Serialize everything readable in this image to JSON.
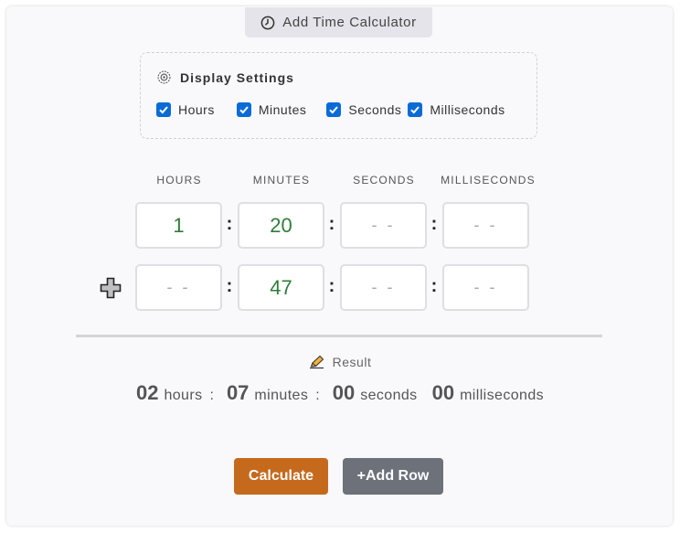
{
  "header": {
    "title": "Add Time Calculator",
    "icon": "clock-icon"
  },
  "settings": {
    "title": "Display Settings",
    "icon": "gear-icon",
    "options": [
      {
        "label": "Hours",
        "checked": true
      },
      {
        "label": "Minutes",
        "checked": true
      },
      {
        "label": "Seconds",
        "checked": true
      },
      {
        "label": "Milliseconds",
        "checked": true
      }
    ]
  },
  "columns": [
    "HOURS",
    "MINUTES",
    "SECONDS",
    "MILLISECONDS"
  ],
  "rows": [
    {
      "operator": "",
      "values": [
        "1",
        "20",
        "- -",
        "- -"
      ]
    },
    {
      "operator": "plus",
      "values": [
        "- -",
        "47",
        "- -",
        "- -"
      ]
    }
  ],
  "result": {
    "label": "Result",
    "icon": "pencil-icon",
    "hours": "02",
    "hours_unit": "hours",
    "minutes": "07",
    "minutes_unit": "minutes",
    "seconds": "00",
    "seconds_unit": "seconds",
    "milliseconds": "00",
    "milliseconds_unit": "milliseconds",
    "separator": ":"
  },
  "buttons": {
    "calculate": "Calculate",
    "add_row": "+Add Row"
  },
  "colors": {
    "checkbox": "#0b6bd6",
    "value_text": "#2f7d3a",
    "calculate_bg": "#c56a1d",
    "add_row_bg": "#6c717a"
  }
}
